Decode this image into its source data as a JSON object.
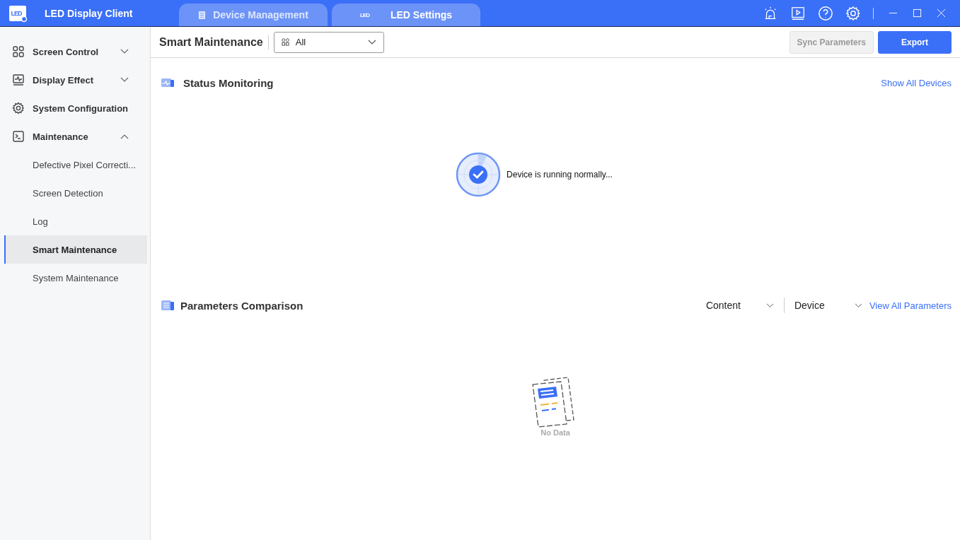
{
  "window": {
    "logo_text": "LED",
    "title": "LED Display Client"
  },
  "tabs": [
    {
      "label": "Device Management",
      "kind": "document",
      "selected": false
    },
    {
      "label": "LED Settings",
      "kind": "led",
      "icon_text": "LED",
      "selected": true
    }
  ],
  "sidebar": {
    "items": [
      {
        "label": "Screen Control",
        "kind": "grid",
        "expanded": false
      },
      {
        "label": "Display Effect",
        "kind": "chart",
        "expanded": false
      },
      {
        "label": "System Configuration",
        "kind": "gear"
      },
      {
        "label": "Maintenance",
        "kind": "terminal",
        "expanded": true,
        "children": [
          {
            "label": "Defective Pixel Correcti...",
            "selected": false
          },
          {
            "label": "Screen Detection",
            "selected": false
          },
          {
            "label": "Log",
            "selected": false
          },
          {
            "label": "Smart Maintenance",
            "selected": true
          },
          {
            "label": "System Maintenance",
            "selected": false
          }
        ]
      }
    ]
  },
  "toolbar": {
    "title": "Smart Maintenance",
    "filter": {
      "value": "All"
    },
    "buttons": [
      {
        "label": "Sync Parameters",
        "disabled": true
      },
      {
        "label": "Export",
        "disabled": false
      }
    ]
  },
  "status_monitoring": {
    "title": "Status Monitoring",
    "link": "Show All Devices",
    "message": "Device is running normally..."
  },
  "parameters_comparison": {
    "title": "Parameters Comparison",
    "dropdowns": [
      "Content",
      "Device"
    ],
    "link": "View All Parameters",
    "empty_text": "No Data"
  }
}
